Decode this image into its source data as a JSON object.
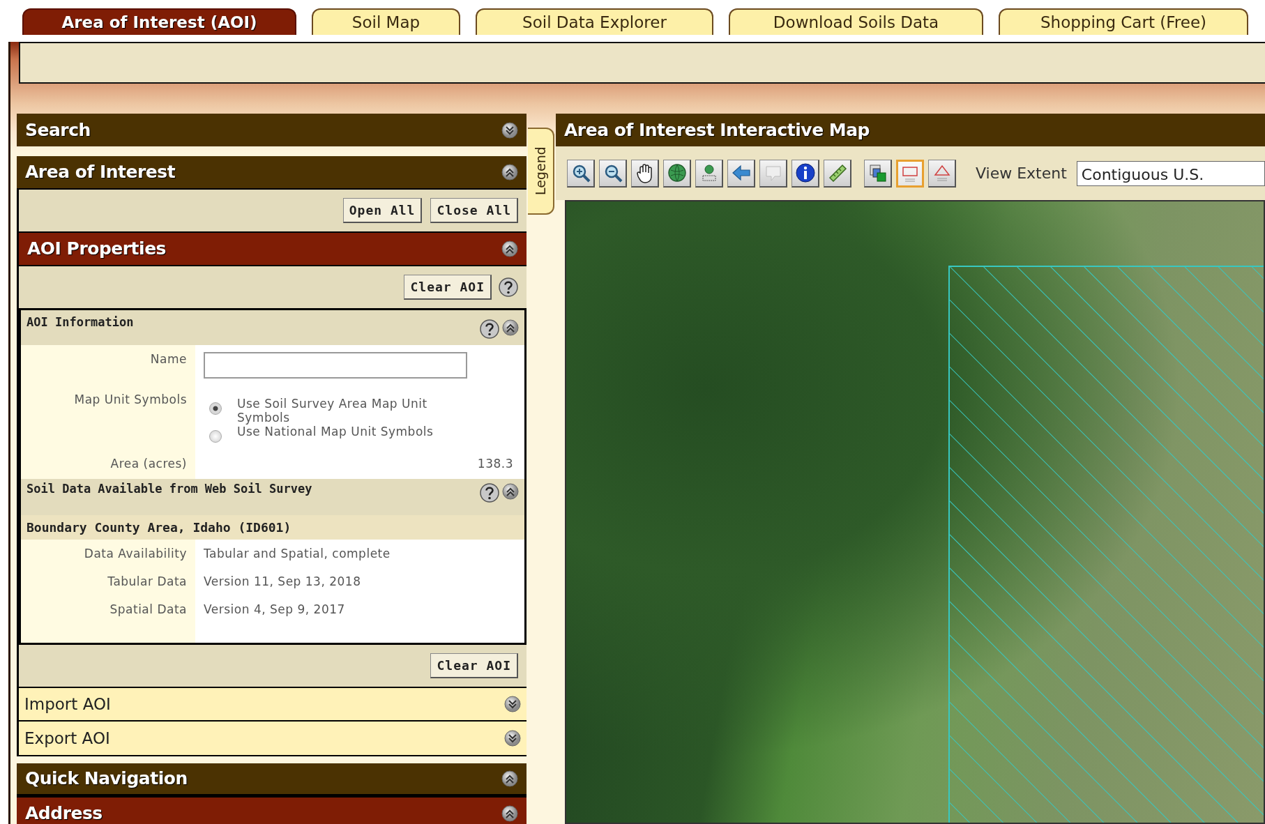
{
  "tabs": [
    {
      "label": "Area of Interest (AOI)",
      "selected": true
    },
    {
      "label": "Soil Map",
      "selected": false
    },
    {
      "label": "Soil Data Explorer",
      "selected": false
    },
    {
      "label": "Download Soils Data",
      "selected": false
    },
    {
      "label": "Shopping Cart (Free)",
      "selected": false
    }
  ],
  "search_section": {
    "title": "Search",
    "expanded": false
  },
  "area_of_interest": {
    "title": "Area of Interest",
    "expanded": true,
    "buttons": [
      "Open All",
      "Close All"
    ]
  },
  "aoi_properties": {
    "title": "AOI Properties",
    "expanded": true,
    "clear_button": "Clear AOI",
    "aoi_information": {
      "title": "AOI Information",
      "expanded": true,
      "name_label": "Name",
      "symbols_label": "Map Unit Symbols",
      "options": [
        {
          "label": "Use Soil Survey Area Map Unit Symbols",
          "selected": true
        },
        {
          "label": "Use National Map Unit Symbols",
          "selected": false
        }
      ],
      "area_label": "Area (acres)",
      "area_value": "138.3"
    },
    "soil_data": {
      "title": "Soil Data Available from Web Soil Survey",
      "expanded": true,
      "survey_area": "Boundary County Area, Idaho (ID601)",
      "rows": [
        {
          "label": "Data Availability",
          "value": "Tabular and Spatial, complete"
        },
        {
          "label": "Tabular Data",
          "value": "Version 11, Sep 13, 2018"
        },
        {
          "label": "Spatial Data",
          "value": "Version 4, Sep 9, 2017"
        }
      ]
    },
    "bottom_button": "Clear AOI"
  },
  "subsections": [
    {
      "title": "Import AOI",
      "expanded": false
    },
    {
      "title": "Export AOI",
      "expanded": false
    }
  ],
  "quick_navigation": {
    "title": "Quick Navigation",
    "expanded": true
  },
  "address": {
    "title": "Address",
    "expanded": true
  },
  "legend_tab": {
    "label": "Legend"
  },
  "map": {
    "title": "Area of Interest Interactive Map",
    "tools": [
      {
        "kind": "zoom-in",
        "selected": false
      },
      {
        "kind": "zoom-out",
        "selected": false
      },
      {
        "kind": "pan",
        "selected": false
      },
      {
        "kind": "globe",
        "selected": false
      },
      {
        "kind": "point",
        "selected": false
      },
      {
        "kind": "back",
        "selected": false
      },
      {
        "kind": "pointer",
        "selected": false
      },
      {
        "kind": "info",
        "selected": false
      },
      {
        "kind": "ruler",
        "selected": false
      },
      {
        "kind": "layers",
        "selected": false
      },
      {
        "kind": "rectangle",
        "selected": true
      },
      {
        "kind": "polygon",
        "selected": false
      }
    ],
    "view_extent_label": "View Extent",
    "view_extent_value": "Contiguous U.S."
  }
}
